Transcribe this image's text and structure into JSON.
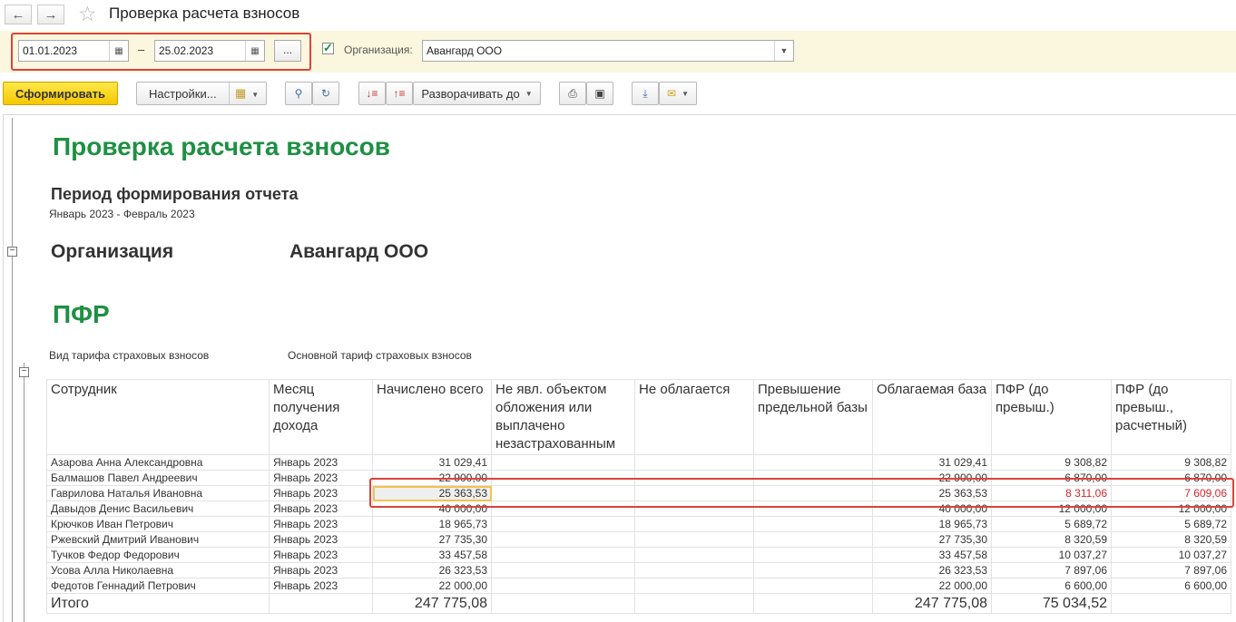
{
  "window": {
    "title": "Проверка расчета взносов"
  },
  "filters": {
    "date_from": "01.01.2023",
    "date_to": "25.02.2023",
    "dash": "–",
    "ellipsis_label": "...",
    "org_label": "Организация:",
    "org_value": "Авангард ООО"
  },
  "toolbar": {
    "generate_label": "Сформировать",
    "settings_label": "Настройки...",
    "expand_label": "Разворачивать до"
  },
  "report": {
    "title": "Проверка расчета взносов",
    "period_heading": "Период формирования отчета",
    "period_value": "Январь 2023 - Февраль 2023",
    "org_label": "Организация",
    "org_value": "Авангард ООО",
    "section": "ПФР",
    "tariff_label": "Вид тарифа страховых взносов",
    "tariff_value": "Основной тариф страховых взносов",
    "columns": [
      "Сотрудник",
      "Месяц получения дохода",
      "Начислено всего",
      "Не явл. объектом обложения или выплачено незастрахованным",
      "Не облагается",
      "Превышение предельной базы",
      "Облагаемая база",
      "ПФР (до превыш.)",
      "ПФР (до превыш., расчетный)"
    ],
    "rows": [
      [
        "Азарова Анна Александровна",
        "Январь 2023",
        "31 029,41",
        "",
        "",
        "",
        "31 029,41",
        "9 308,82",
        "9 308,82"
      ],
      [
        "Балмашов Павел Андреевич",
        "Январь 2023",
        "22 900,00",
        "",
        "",
        "",
        "22 900,00",
        "6 870,00",
        "6 870,00"
      ],
      [
        "Гаврилова Наталья Ивановна",
        "Январь 2023",
        "25 363,53",
        "",
        "",
        "",
        "25 363,53",
        "8 311,06",
        "7 609,06"
      ],
      [
        "Давыдов Денис Васильевич",
        "Январь 2023",
        "40 000,00",
        "",
        "",
        "",
        "40 000,00",
        "12 000,00",
        "12 000,00"
      ],
      [
        "Крючков Иван Петрович",
        "Январь 2023",
        "18 965,73",
        "",
        "",
        "",
        "18 965,73",
        "5 689,72",
        "5 689,72"
      ],
      [
        "Ржевский Дмитрий Иванович",
        "Январь 2023",
        "27 735,30",
        "",
        "",
        "",
        "27 735,30",
        "8 320,59",
        "8 320,59"
      ],
      [
        "Тучков Федор Федорович",
        "Январь 2023",
        "33 457,58",
        "",
        "",
        "",
        "33 457,58",
        "10 037,27",
        "10 037,27"
      ],
      [
        "Усова Алла Николаевна",
        "Январь 2023",
        "26 323,53",
        "",
        "",
        "",
        "26 323,53",
        "7 897,06",
        "7 897,06"
      ],
      [
        "Федотов Геннадий Петрович",
        "Январь 2023",
        "22 000,00",
        "",
        "",
        "",
        "22 000,00",
        "6 600,00",
        "6 600,00"
      ]
    ],
    "total": [
      "Итого",
      "",
      "247 775,08",
      "",
      "",
      "",
      "247 775,08",
      "75 034,52",
      ""
    ]
  },
  "colors": {
    "accent_green": "#1f8f44",
    "highlight_red": "#d3262c",
    "primary_button": "#f6c700"
  }
}
